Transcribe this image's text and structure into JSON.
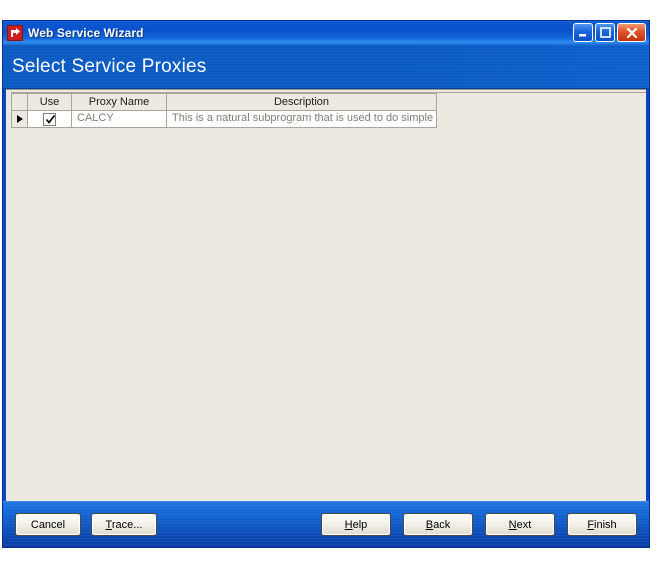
{
  "window": {
    "title": "Web Service Wizard",
    "app_icon": "wizard-arrow-icon",
    "caption": {
      "minimize_label": "Minimize",
      "maximize_label": "Maximize",
      "close_label": "Close"
    }
  },
  "banner": {
    "heading": "Select Service Proxies",
    "background_color": "#0A5AC2"
  },
  "grid": {
    "columns": [
      "Use",
      "Proxy Name",
      "Description"
    ],
    "rows": [
      {
        "selected": true,
        "use_checked": true,
        "proxy_name": "CALCY",
        "description": "This is a natural subprogram that is used to do simple"
      }
    ]
  },
  "buttons": {
    "cancel": {
      "label": "Cancel",
      "mnemonic": ""
    },
    "trace": {
      "label": "Trace...",
      "mnemonic": "T"
    },
    "help": {
      "label": "Help",
      "mnemonic": "H"
    },
    "back": {
      "label": "Back",
      "mnemonic": "B"
    },
    "next": {
      "label": "Next",
      "mnemonic": "N"
    },
    "finish": {
      "label": "Finish",
      "mnemonic": "F"
    }
  },
  "colors": {
    "titlebar_blue": "#0A52CC",
    "banner_blue": "#0A5AC2",
    "content_bg": "#ECE9E0",
    "close_red": "#C3310D"
  }
}
